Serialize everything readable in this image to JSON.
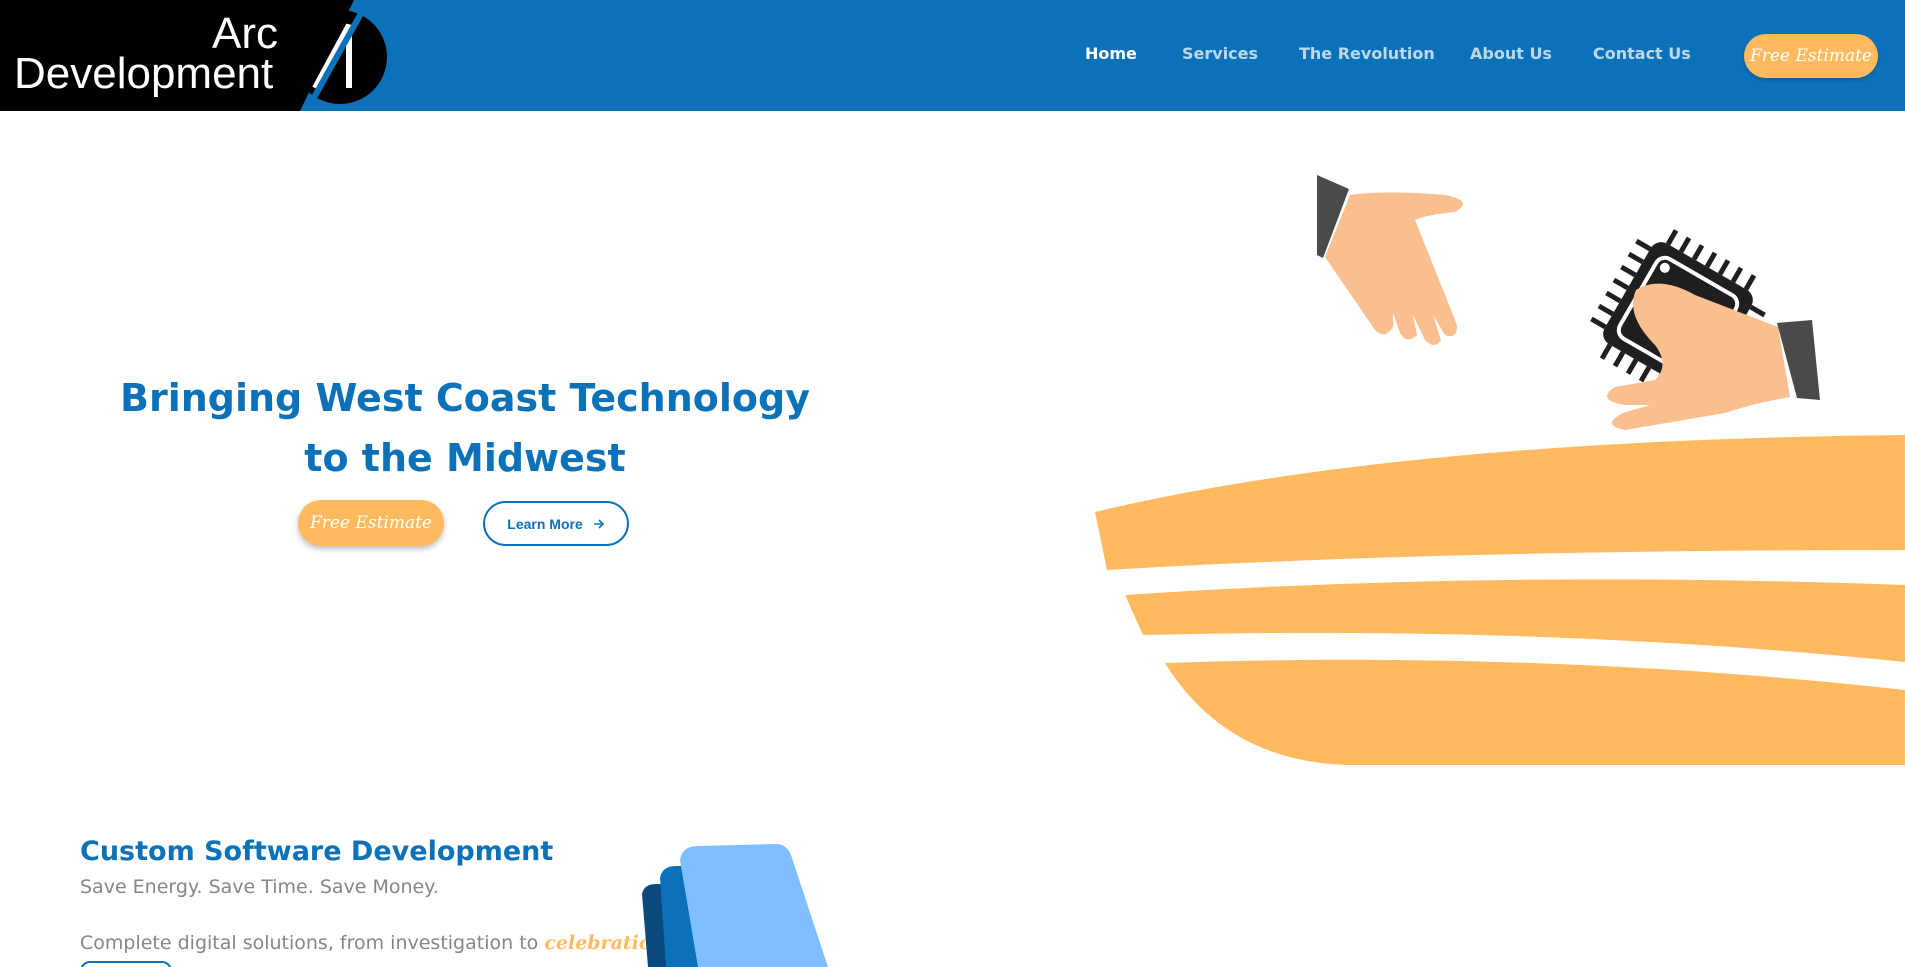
{
  "header": {
    "logo": {
      "line1": "Arc",
      "line2": "Development"
    },
    "nav": [
      {
        "label": "Home",
        "active": true
      },
      {
        "label": "Services",
        "active": false
      },
      {
        "label": "The Revolution",
        "active": false
      },
      {
        "label": "About Us",
        "active": false
      },
      {
        "label": "Contact Us",
        "active": false
      }
    ],
    "cta_label": "Free Estimate"
  },
  "hero": {
    "title_line1": "Bringing West Coast Technology",
    "title_line2": "to the Midwest",
    "estimate_label": "Free Estimate",
    "learn_label": "Learn More"
  },
  "services": {
    "title": "Custom Software Development",
    "subtitle": "Save Energy. Save Time. Save Money.",
    "desc_prefix": "Complete digital solutions, from investigation to ",
    "desc_accent": "celebration."
  },
  "colors": {
    "primary_blue": "#0B72B9",
    "accent_orange": "#FFBA60",
    "text_grey": "#868686"
  },
  "icons": {
    "arrow": "arrow-right-icon",
    "logo_mark": "arc-logo-icon"
  }
}
